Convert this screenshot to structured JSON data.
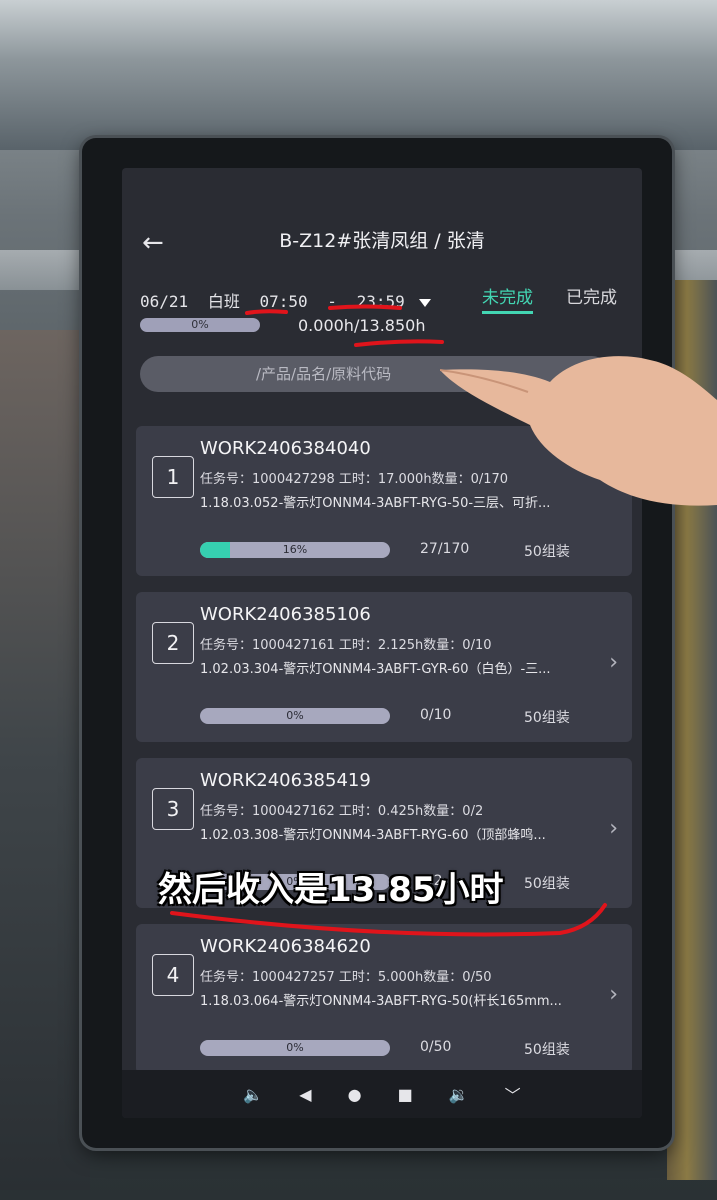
{
  "header": {
    "title": "B-Z12#张清凤组 / 张清",
    "back_icon": "back-arrow-icon"
  },
  "shift": {
    "date": "06/21",
    "name": "白班",
    "start": "07:50",
    "separator": "-",
    "end": "23:59",
    "overall_progress_label": "0%",
    "overall_progress_value": 0,
    "hours": "0.000h/13.850h"
  },
  "tabs": {
    "pending": "未完成",
    "done": "已完成"
  },
  "search": {
    "placeholder": "/产品/品名/原料代码"
  },
  "tasks": [
    {
      "index": "1",
      "code": "WORK2406384040",
      "meta": "任务号：1000427298  工时：17.000h数量：0/170",
      "desc": "1.18.03.052-警示灯ONNM4-3ABFT-RYG-50-三层、可折...",
      "progress_label": "16%",
      "progress_value": 16,
      "count": "27/170",
      "group": "50组装"
    },
    {
      "index": "2",
      "code": "WORK2406385106",
      "meta": "任务号：1000427161  工时：2.125h数量：0/10",
      "desc": "1.02.03.304-警示灯ONNM4-3ABFT-GYR-60（白色）-三...",
      "progress_label": "0%",
      "progress_value": 0,
      "count": "0/10",
      "group": "50组装"
    },
    {
      "index": "3",
      "code": "WORK2406385419",
      "meta": "任务号：1000427162  工时：0.425h数量：0/2",
      "desc": "1.02.03.308-警示灯ONNM4-3ABFT-RYG-60（顶部蜂鸣...",
      "progress_label": "0%",
      "progress_value": 0,
      "count": "0/2",
      "group": "50组装"
    },
    {
      "index": "4",
      "code": "WORK2406384620",
      "meta": "任务号：1000427257  工时：5.000h数量：0/50",
      "desc": "1.18.03.064-警示灯ONNM4-3ABFT-RYG-50(杆长165mm...",
      "progress_label": "0%",
      "progress_value": 0,
      "count": "0/50",
      "group": "50组装"
    }
  ],
  "subtitle": "然后收入是13.85小时",
  "colors": {
    "accent": "#43d6b3",
    "card": "#3b3d48",
    "screen": "#2a2c33",
    "annotation": "#e0141b"
  }
}
